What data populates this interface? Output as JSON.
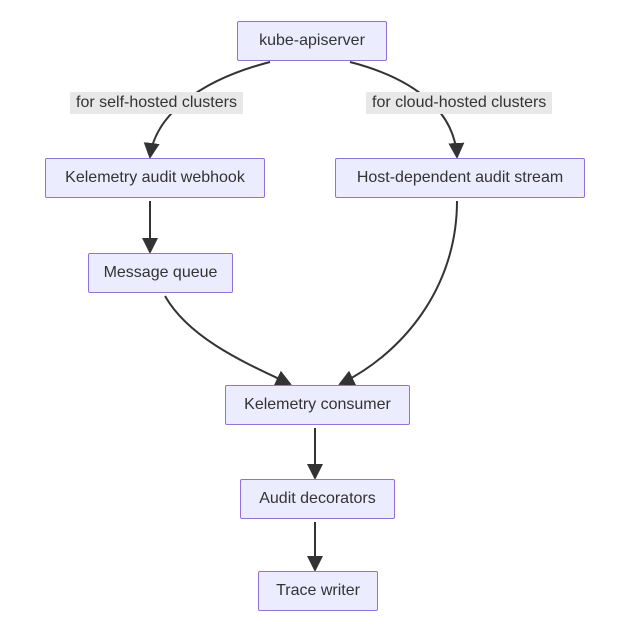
{
  "nodes": {
    "apiserver": "kube-apiserver",
    "webhook": "Kelemetry audit webhook",
    "hostStream": "Host-dependent audit stream",
    "mq": "Message queue",
    "consumer": "Kelemetry consumer",
    "decorators": "Audit decorators",
    "writer": "Trace writer"
  },
  "edges": {
    "selfHosted": "for self-hosted clusters",
    "cloudHosted": "for cloud-hosted clusters"
  },
  "chart_data": {
    "type": "diagram",
    "title": "",
    "nodes": [
      {
        "id": "apiserver",
        "label": "kube-apiserver"
      },
      {
        "id": "webhook",
        "label": "Kelemetry audit webhook"
      },
      {
        "id": "hostStream",
        "label": "Host-dependent audit stream"
      },
      {
        "id": "mq",
        "label": "Message queue"
      },
      {
        "id": "consumer",
        "label": "Kelemetry consumer"
      },
      {
        "id": "decorators",
        "label": "Audit decorators"
      },
      {
        "id": "writer",
        "label": "Trace writer"
      }
    ],
    "edges": [
      {
        "from": "apiserver",
        "to": "webhook",
        "label": "for self-hosted clusters"
      },
      {
        "from": "apiserver",
        "to": "hostStream",
        "label": "for cloud-hosted clusters"
      },
      {
        "from": "webhook",
        "to": "mq",
        "label": ""
      },
      {
        "from": "mq",
        "to": "consumer",
        "label": ""
      },
      {
        "from": "hostStream",
        "to": "consumer",
        "label": ""
      },
      {
        "from": "consumer",
        "to": "decorators",
        "label": ""
      },
      {
        "from": "decorators",
        "to": "writer",
        "label": ""
      }
    ]
  }
}
